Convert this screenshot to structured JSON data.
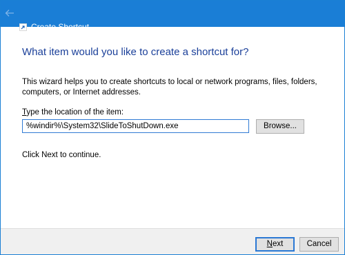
{
  "window": {
    "title": "Create Shortcut",
    "accent_color": "#1a7ed6"
  },
  "icons": {
    "back": "back-arrow-icon",
    "app": "shortcut-app-icon"
  },
  "main": {
    "heading": "What item would you like to create a shortcut for?",
    "description": "This wizard helps you to create shortcuts to local or network programs, files, folders, computers, or Internet addresses.",
    "field_label_access": "T",
    "field_label_rest": "ype the location of the item:",
    "location_value": "%windir%\\System32\\SlideToShutDown.exe",
    "browse_label": "Browse...",
    "continue_text": "Click Next to continue."
  },
  "footer": {
    "next_label": "Next",
    "cancel_label": "Cancel"
  }
}
